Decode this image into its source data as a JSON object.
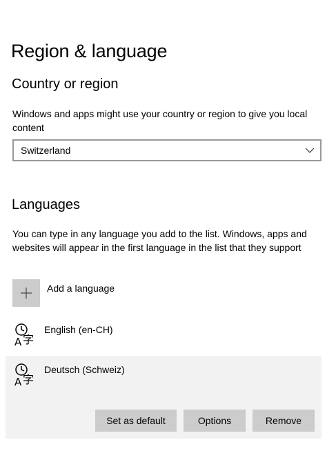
{
  "page": {
    "title": "Region & language"
  },
  "country": {
    "heading": "Country or region",
    "description": "Windows and apps might use your country or region to give you local content",
    "selected": "Switzerland"
  },
  "languages": {
    "heading": "Languages",
    "description": "You can type in any language you add to the list. Windows, apps and websites will appear in the first language in the list that they support",
    "add_label": "Add a language",
    "items": [
      {
        "name": "English (en-CH)",
        "icon": "language-icon"
      },
      {
        "name": "Deutsch (Schweiz)",
        "icon": "language-icon"
      }
    ],
    "actions": {
      "set_default": "Set as default",
      "options": "Options",
      "remove": "Remove"
    }
  },
  "colors": {
    "button_bg": "#cccccc",
    "selected_row_bg": "#f2f2f2",
    "dropdown_border": "#999999"
  }
}
